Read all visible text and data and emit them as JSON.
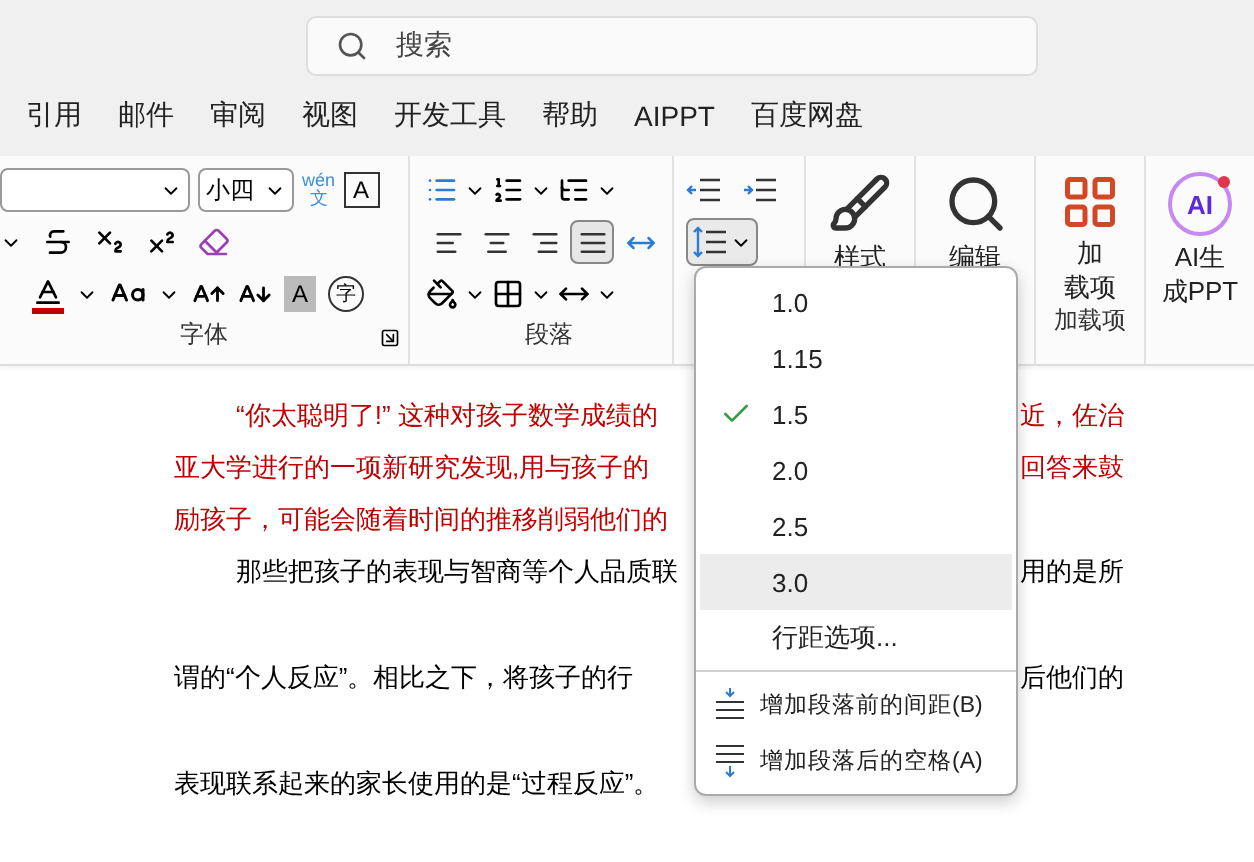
{
  "search": {
    "placeholder": "搜索"
  },
  "tabs": [
    {
      "label": "引用"
    },
    {
      "label": "邮件"
    },
    {
      "label": "审阅"
    },
    {
      "label": "视图"
    },
    {
      "label": "开发工具"
    },
    {
      "label": "帮助"
    },
    {
      "label": "AIPPT"
    },
    {
      "label": "百度网盘"
    }
  ],
  "font_group": {
    "size": "小四",
    "phonetic_top": "wén",
    "phonetic_bottom": "文",
    "char_border": "A",
    "shading": "A",
    "enclose": "字",
    "label": "字体"
  },
  "paragraph_group": {
    "label": "段落",
    "align": [
      {
        "kind": "left",
        "selected": false
      },
      {
        "kind": "center",
        "selected": false
      },
      {
        "kind": "right",
        "selected": false
      },
      {
        "kind": "justify",
        "selected": true
      },
      {
        "kind": "distributed",
        "selected": false
      }
    ]
  },
  "line_spacing_button": {
    "expanded": true
  },
  "styles": {
    "label": "样式"
  },
  "editing": {
    "label": "编辑"
  },
  "addins": {
    "lines": [
      "加",
      "载项"
    ],
    "group_label": "加载项"
  },
  "ai": {
    "logo": "AI",
    "lines": [
      "AI生",
      "成PPT"
    ]
  },
  "spacing_menu": {
    "items": [
      {
        "label": "1.0",
        "checked": false,
        "hovered": false
      },
      {
        "label": "1.15",
        "checked": false,
        "hovered": false
      },
      {
        "label": "1.5",
        "checked": true,
        "hovered": false
      },
      {
        "label": "2.0",
        "checked": false,
        "hovered": false
      },
      {
        "label": "2.5",
        "checked": false,
        "hovered": false
      },
      {
        "label": "3.0",
        "checked": false,
        "hovered": true
      },
      {
        "label": "行距选项...",
        "checked": false,
        "hovered": false
      }
    ],
    "actions": [
      {
        "kind": "before",
        "label": "增加段落前的间距(B)"
      },
      {
        "kind": "after",
        "label": "增加段落后的空格(A)"
      }
    ]
  },
  "document": {
    "paragraphs": [
      {
        "color": "#c00000",
        "kind": "single-spaced",
        "lines": [
          {
            "indent": true,
            "left": "“你太聪明了!” 这种对孩子数学成绩的",
            "right": "近，佐治"
          },
          {
            "indent": false,
            "left": "亚大学进行的一项新研究发现,用与孩子的",
            "right": "回答来鼓"
          },
          {
            "indent": false,
            "left": "励孩子，可能会随着时间的推移削弱他们的"
          }
        ]
      },
      {
        "color": "#000000",
        "kind": "double-spaced",
        "lines": [
          {
            "indent": true,
            "left": "那些把孩子的表现与智商等个人品质联",
            "right": "用的是所"
          },
          {
            "indent": false,
            "left": "谓的“个人反应”。相比之下，将孩子的行",
            "right": "后他们的"
          },
          {
            "indent": false,
            "left": "表现联系起来的家长使用的是“过程反应”。"
          }
        ]
      }
    ]
  }
}
